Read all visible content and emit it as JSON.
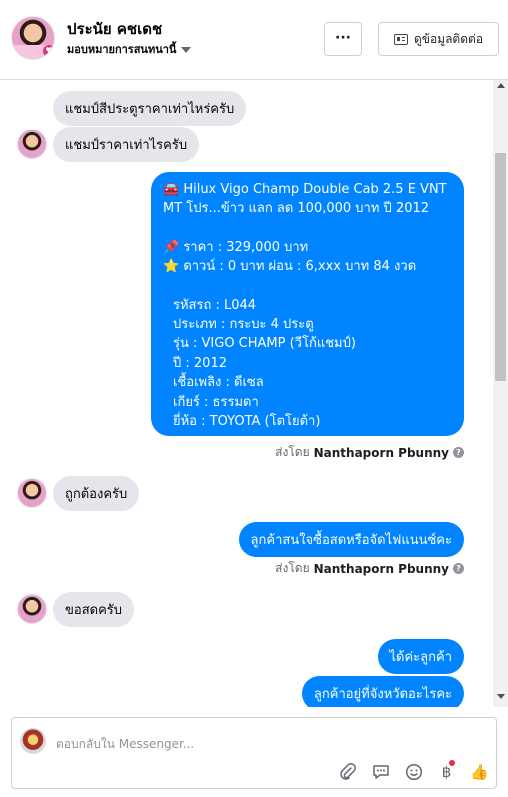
{
  "header": {
    "name": "ประนัย คชเดช",
    "assign": "มอบหมายการสนทนานี้",
    "more_label": "···",
    "contact_label": "ดูข้อมูลติดต่อ"
  },
  "icons": {
    "more": "more-horizontal-icon",
    "contact": "contact-card-icon",
    "assign": "chevron-down-icon"
  },
  "messages": {
    "m1": "แชมป์สีประตูราคาเท่าไหร่ครับ",
    "m2": "แชมป์ราคาเท่าไรครับ",
    "listing": {
      "line1": "🚘 Hilux Vigo Champ Double Cab 2.5 E VNT",
      "line2": "MT โปร...ข้าว แลก ลด 100,000 บาท ปี 2012",
      "line3": "📌 ราคา : 329,000 บาท",
      "line4": "⭐ ดาวน์ : 0 บาท ผ่อน : 6,xxx บาท 84 งวด",
      "line5": "รหัสรถ : L044",
      "line6": "ประเภท : กระบะ 4 ประตู",
      "line7": "รุ่น : VIGO CHAMP (วีโก้แชมป์)",
      "line8": "ปี : 2012",
      "line9": "เชื้อเพลิง : ดีเซล",
      "line10": "เกียร์ : ธรรมดา",
      "line11": "ยี่ห้อ : TOYOTA (โตโยต้า)"
    },
    "sent_prefix": "ส่งโดย",
    "sender": "Nanthaporn Pbunny",
    "m3": "ถูกต้องครับ",
    "m4": "ลูกค้าสนใจซื้อสดหรือจัดไฟแนนซ์คะ",
    "m5": "ขอสดครับ",
    "m6": "ได้ค่ะลูกค้า",
    "m7": "ลูกค้าอยู่ที่จังหวัดอะไรคะ"
  },
  "composer": {
    "placeholder": "ตอบกลับใน Messenger...",
    "tools": [
      "attachment-icon",
      "saved-replies-icon",
      "emoji-icon",
      "payment-icon",
      "like-icon"
    ],
    "payment_glyph": "฿",
    "like_glyph": "👍"
  },
  "colors": {
    "outgoing": "#0084ff",
    "incoming": "#e4e6eb"
  }
}
